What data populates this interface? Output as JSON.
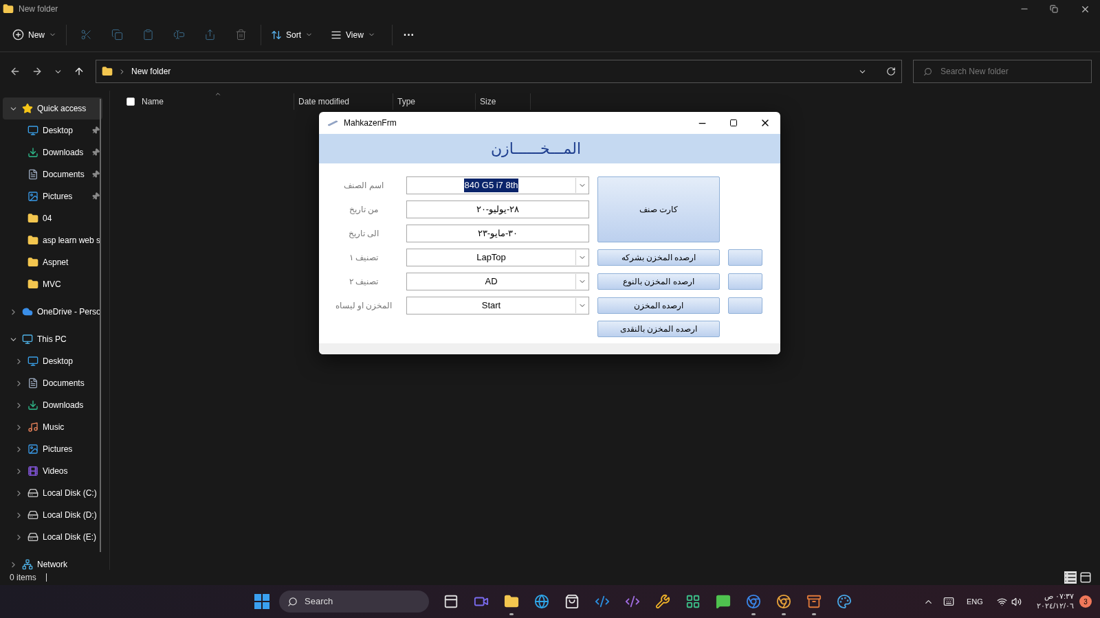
{
  "window": {
    "title": "New folder"
  },
  "toolbar": {
    "new": "New",
    "sort": "Sort",
    "view": "View",
    "more": "···"
  },
  "address": {
    "crumb": "New folder",
    "search_placeholder": "Search New folder"
  },
  "sidebar": {
    "items": [
      {
        "label": "Quick access",
        "kind": "star",
        "expanded": true,
        "selected": true,
        "children": [
          {
            "label": "Desktop",
            "kind": "desktop",
            "pinned": true,
            "selected": false
          },
          {
            "label": "Downloads",
            "kind": "downloads",
            "pinned": true,
            "selected": false
          },
          {
            "label": "Documents",
            "kind": "documents",
            "pinned": true,
            "selected": false
          },
          {
            "label": "Pictures",
            "kind": "pictures",
            "pinned": true,
            "selected": false
          },
          {
            "label": "04",
            "kind": "folder",
            "pinned": false,
            "selected": false
          },
          {
            "label": "asp learn web s",
            "kind": "folder",
            "pinned": false,
            "selected": false
          },
          {
            "label": "Aspnet",
            "kind": "folder",
            "pinned": false,
            "selected": false
          },
          {
            "label": "MVC",
            "kind": "folder",
            "pinned": false,
            "selected": false
          }
        ]
      },
      {
        "label": "OneDrive - Perso",
        "kind": "cloud",
        "expanded": false,
        "selected": false
      },
      {
        "label": "This PC",
        "kind": "pc",
        "expanded": true,
        "selected": false,
        "children": [
          {
            "label": "Desktop",
            "kind": "desktop",
            "expanded": false,
            "selected": false
          },
          {
            "label": "Documents",
            "kind": "documents",
            "expanded": false,
            "selected": false
          },
          {
            "label": "Downloads",
            "kind": "downloads",
            "expanded": false,
            "selected": false
          },
          {
            "label": "Music",
            "kind": "music",
            "expanded": false,
            "selected": false
          },
          {
            "label": "Pictures",
            "kind": "pictures",
            "expanded": false,
            "selected": false
          },
          {
            "label": "Videos",
            "kind": "videos",
            "expanded": false,
            "selected": false
          },
          {
            "label": "Local Disk (C:)",
            "kind": "disk",
            "expanded": false,
            "selected": false
          },
          {
            "label": "Local Disk (D:)",
            "kind": "disk",
            "expanded": false,
            "selected": false
          },
          {
            "label": "Local Disk (E:)",
            "kind": "disk",
            "expanded": false,
            "selected": false
          }
        ]
      },
      {
        "label": "Network",
        "kind": "network",
        "expanded": false,
        "selected": false
      }
    ]
  },
  "table": {
    "columns": [
      "Name",
      "Date modified",
      "Type",
      "Size"
    ],
    "select_all": false
  },
  "status_bar": {
    "count": "0 items",
    "details_selected": true
  },
  "dialog": {
    "title": "MahkazenFrm",
    "header": "المـــخــــــازن",
    "rows": [
      {
        "label": "اسم الصنف",
        "kind": "combo",
        "value": "840 G5 i7 8th",
        "highlighted": true
      },
      {
        "label": "من تاريخ",
        "kind": "text",
        "value": "٢٨-يوليو-٢٠",
        "highlighted": false
      },
      {
        "label": "الى تاريخ",
        "kind": "text",
        "value": "٣٠-مايو-٢٣",
        "highlighted": false
      },
      {
        "label": "تصنيف ١",
        "kind": "combo",
        "value": "LapTop",
        "highlighted": false
      },
      {
        "label": "تصنيف ٢",
        "kind": "combo",
        "value": "AD",
        "highlighted": false
      },
      {
        "label": "المخزن او ليساه",
        "kind": "combo",
        "value": "Start",
        "highlighted": false
      }
    ],
    "card_button": "كارت صنف",
    "actions": [
      {
        "label": "ارصده المخزن بشركه",
        "blank_button": true
      },
      {
        "label": "ارصده المخزن بالنوع",
        "blank_button": true
      },
      {
        "label": "ارصده المخزن",
        "blank_button": true
      },
      {
        "label": "ارصده المخزن بالنقدى",
        "blank_button": false
      }
    ]
  },
  "taskbar": {
    "search": "Search",
    "apps": [
      {
        "kind": "taskview",
        "running": false
      },
      {
        "kind": "meet",
        "running": false
      },
      {
        "kind": "explorer",
        "running": true
      },
      {
        "kind": "edge",
        "running": false
      },
      {
        "kind": "store",
        "running": false
      },
      {
        "kind": "vscode",
        "running": false
      },
      {
        "kind": "vstudio",
        "running": false
      },
      {
        "kind": "tools",
        "running": false
      },
      {
        "kind": "tiles",
        "running": false
      },
      {
        "kind": "chat",
        "running": false
      },
      {
        "kind": "chromium",
        "running": true
      },
      {
        "kind": "chrome",
        "running": true
      },
      {
        "kind": "archive",
        "running": true
      },
      {
        "kind": "paint",
        "running": false
      }
    ],
    "tray": {
      "language": "ENG",
      "time": "٠٧:٣٧ ص",
      "date": "٢٠٢٤/١٢/٠٦",
      "badge": "3"
    }
  }
}
